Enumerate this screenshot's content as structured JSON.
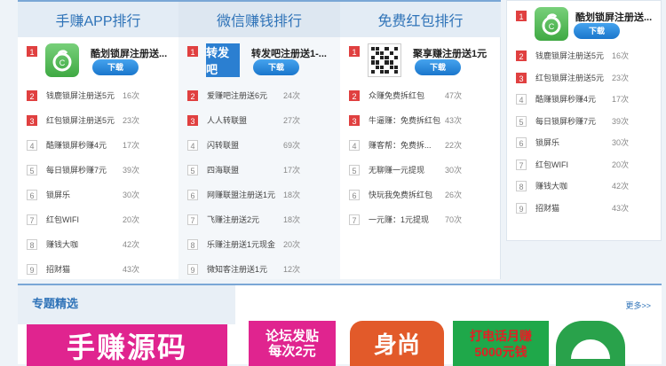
{
  "columns": [
    {
      "title": "手赚APP排行",
      "top": {
        "rank": "1",
        "title": "酷划锁屏注册送...",
        "button": "下载",
        "icon": "lock-app-icon"
      },
      "rows": [
        {
          "rank": "2",
          "name": "钱鹿锁屏注册送5元",
          "count": "16次"
        },
        {
          "rank": "3",
          "name": "红包锁屏注册送5元",
          "count": "23次"
        },
        {
          "rank": "4",
          "name": "酷赚锁屏秒赚4元",
          "count": "17次"
        },
        {
          "rank": "5",
          "name": "每日锁屏秒赚7元",
          "count": "39次"
        },
        {
          "rank": "6",
          "name": "锁屏乐",
          "count": "30次"
        },
        {
          "rank": "7",
          "name": "红包WIFI",
          "count": "20次"
        },
        {
          "rank": "8",
          "name": "赚钱大咖",
          "count": "42次"
        },
        {
          "rank": "9",
          "name": "招财猫",
          "count": "43次"
        }
      ]
    },
    {
      "title": "微信赚钱排行",
      "top": {
        "rank": "1",
        "title": "转发吧注册送1-...",
        "button": "下载",
        "icon_text": "转发吧"
      },
      "rows": [
        {
          "rank": "2",
          "name": "爱赚吧注册送6元",
          "count": "24次"
        },
        {
          "rank": "3",
          "name": "人人转联盟",
          "count": "27次"
        },
        {
          "rank": "4",
          "name": "闪转联盟",
          "count": "69次"
        },
        {
          "rank": "5",
          "name": "四海联盟",
          "count": "17次"
        },
        {
          "rank": "6",
          "name": "网赚联盟注册送1元",
          "count": "18次"
        },
        {
          "rank": "7",
          "name": "飞赚注册送2元",
          "count": "18次"
        },
        {
          "rank": "8",
          "name": "乐赚注册送1元现金",
          "count": "20次"
        },
        {
          "rank": "9",
          "name": "微知客注册送1元",
          "count": "12次"
        }
      ]
    },
    {
      "title": "免费红包排行",
      "top": {
        "rank": "1",
        "title": "聚享赚注册送1元",
        "button": "下载",
        "icon": "qr-code-icon"
      },
      "rows": [
        {
          "rank": "2",
          "name": "众赚免费拆红包",
          "count": "47次"
        },
        {
          "rank": "3",
          "name": "牛逼赚：免费拆红包",
          "count": "43次"
        },
        {
          "rank": "4",
          "name": "赚客帮：免费拆...",
          "count": "22次"
        },
        {
          "rank": "5",
          "name": "无聊赚一元提现",
          "count": "30次"
        },
        {
          "rank": "6",
          "name": "快玩我免费拆红包",
          "count": "26次"
        },
        {
          "rank": "7",
          "name": "一元赚：1元提现",
          "count": "70次"
        }
      ]
    }
  ],
  "side": {
    "top": {
      "rank": "1",
      "title": "酷划锁屏注册送...",
      "button": "下载",
      "icon": "lock-app-icon"
    },
    "rows": [
      {
        "rank": "2",
        "name": "钱鹿锁屏注册送5元",
        "count": "16次"
      },
      {
        "rank": "3",
        "name": "红包锁屏注册送5元",
        "count": "23次"
      },
      {
        "rank": "4",
        "name": "酷赚锁屏秒赚4元",
        "count": "17次"
      },
      {
        "rank": "5",
        "name": "每日锁屏秒赚7元",
        "count": "39次"
      },
      {
        "rank": "6",
        "name": "锁屏乐",
        "count": "30次"
      },
      {
        "rank": "7",
        "name": "红包WIFI",
        "count": "20次"
      },
      {
        "rank": "8",
        "name": "赚钱大咖",
        "count": "42次"
      },
      {
        "rank": "9",
        "name": "招财猫",
        "count": "43次"
      }
    ]
  },
  "featured": {
    "title": "专题精选",
    "more": "更多>>",
    "banners": [
      {
        "text": "手赚源码"
      },
      {
        "line1": "论坛发贴",
        "line2": "每次2元"
      },
      {
        "text": "身尚"
      },
      {
        "line1": "打电话月赚",
        "line2": "5000元钱"
      },
      {
        "icon": "green-app-icon"
      }
    ]
  },
  "colors": {
    "accent": "#2f73b8",
    "rank_red": "#e04040",
    "button_blue": "#1a76cc"
  }
}
